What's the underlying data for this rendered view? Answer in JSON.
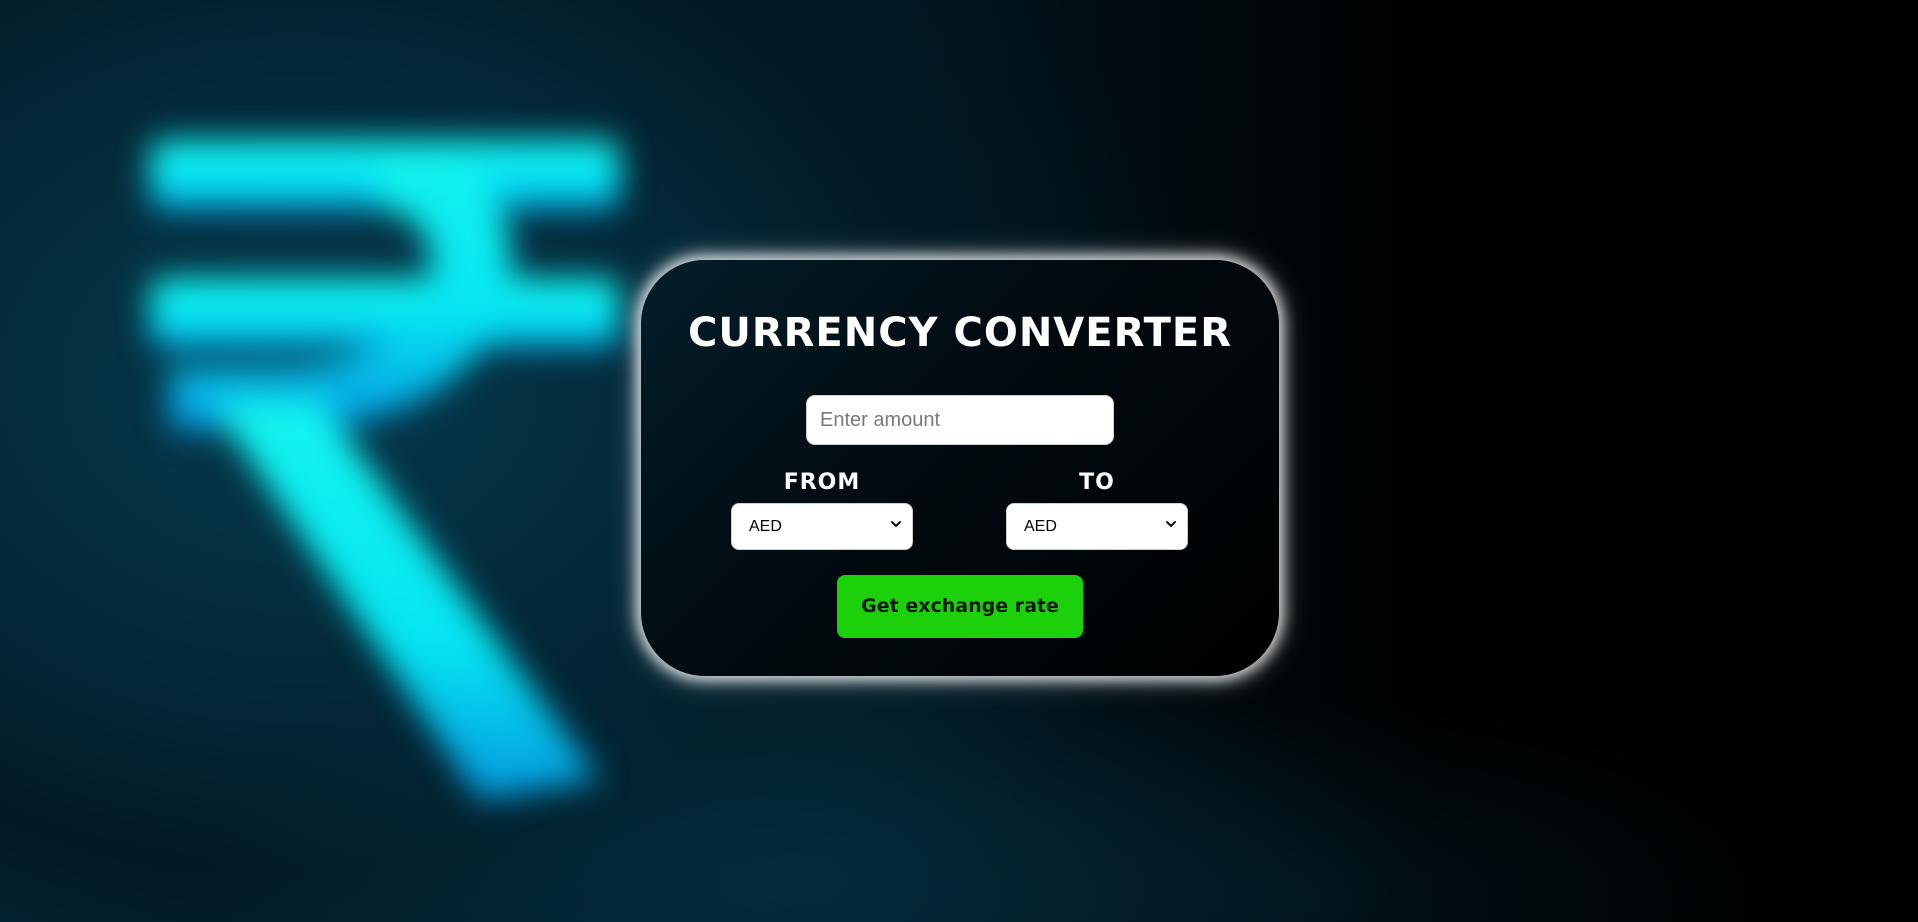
{
  "background": {
    "symbol": "rupee-icon"
  },
  "converter": {
    "title": "CURRENCY CONVERTER",
    "amount_placeholder": "Enter amount",
    "amount_value": "",
    "from_label": "FROM",
    "to_label": "TO",
    "from_selected": "AED",
    "to_selected": "AED",
    "button_label": "Get exchange rate"
  },
  "colors": {
    "button": "#1dd10a",
    "card": "#000000",
    "symbol_glow": "#00f0f0"
  }
}
